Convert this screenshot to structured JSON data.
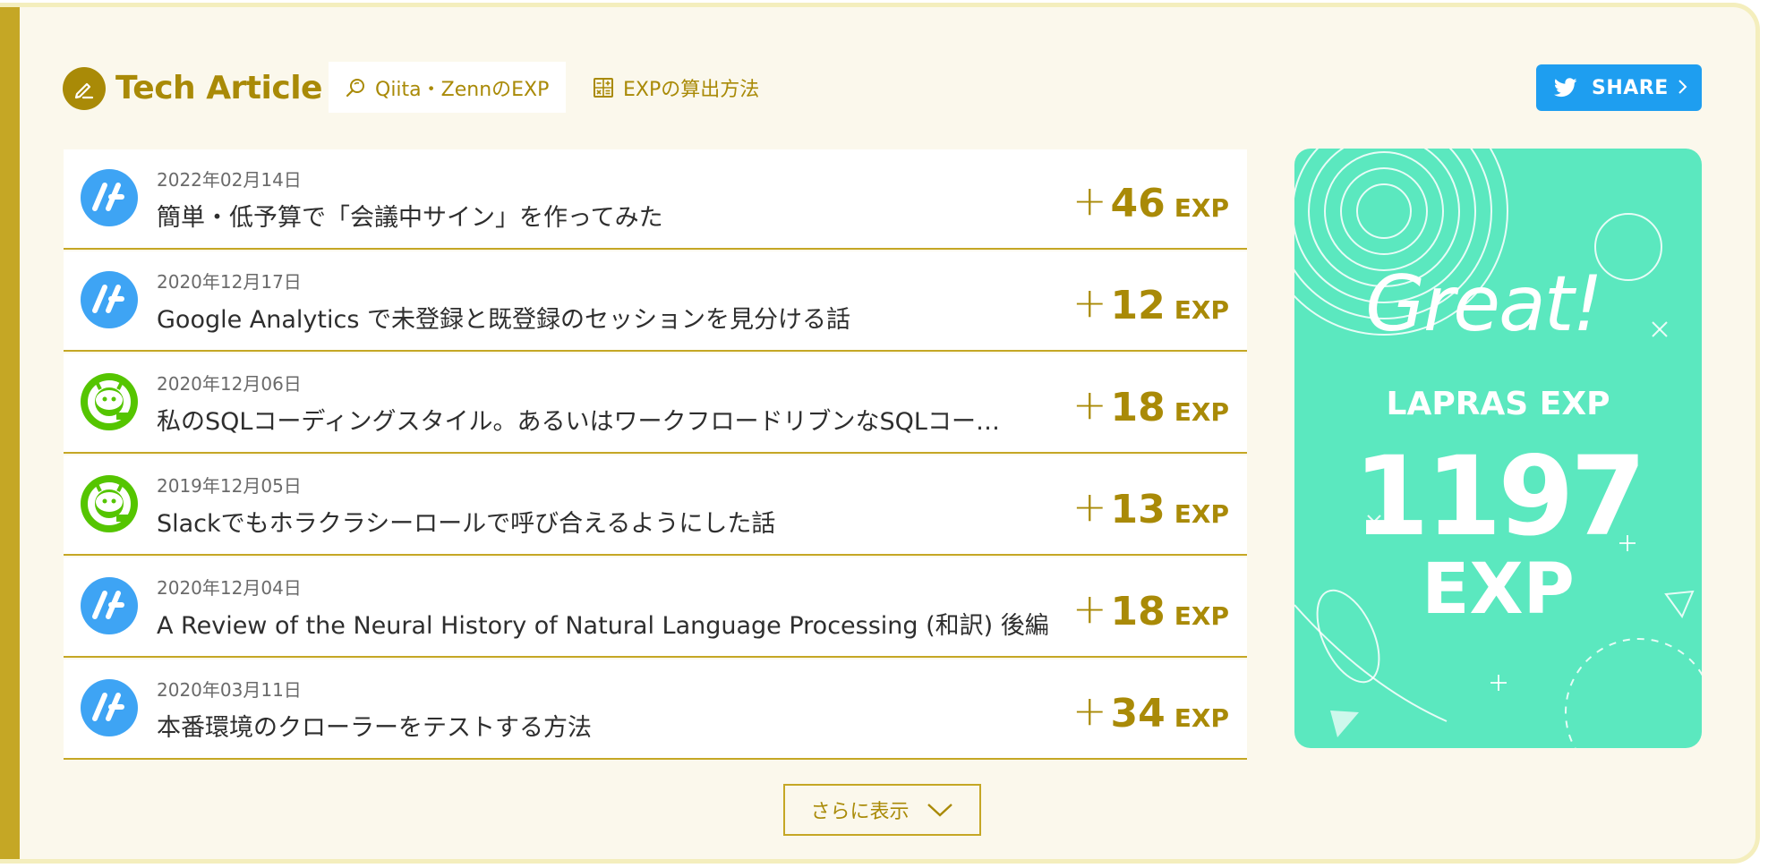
{
  "header": {
    "title": "Tech Article",
    "tabs": [
      {
        "label": "Qiita・ZennのEXP",
        "active": true
      },
      {
        "label": "EXPの算出方法",
        "active": false
      }
    ],
    "share_label": "SHARE"
  },
  "articles": [
    {
      "date": "2022年02月14日",
      "title": "簡単・低予算で「会議中サイン」を作ってみた",
      "exp": "46",
      "source_icon": "hatena-icon"
    },
    {
      "date": "2020年12月17日",
      "title": "Google Analytics で未登録と既登録のセッションを見分ける話",
      "exp": "12",
      "source_icon": "hatena-icon"
    },
    {
      "date": "2020年12月06日",
      "title": "私のSQLコーディングスタイル。あるいはワークフロードリブンなSQLコー…",
      "exp": "18",
      "source_icon": "qiita-icon"
    },
    {
      "date": "2019年12月05日",
      "title": "Slackでもホラクラシーロールで呼び合えるようにした話",
      "exp": "13",
      "source_icon": "qiita-icon"
    },
    {
      "date": "2020年12月04日",
      "title": "A Review of the Neural History of Natural Language Processing (和訳) 後編",
      "exp": "18",
      "source_icon": "hatena-icon"
    },
    {
      "date": "2020年03月11日",
      "title": "本番環境のクローラーをテストする方法",
      "exp": "34",
      "source_icon": "hatena-icon"
    }
  ],
  "exp_plus": "+",
  "exp_unit": "EXP",
  "more_label": "さらに表示",
  "badge": {
    "great": "Great!",
    "label": "LAPRAS EXP",
    "value": "1197",
    "unit": "EXP"
  },
  "colors": {
    "accent": "#a98a07",
    "accent_border": "#c5a725",
    "card_bg": "#fbf8ec",
    "twitter": "#1e9ef0",
    "badge_bg": "#5be8bf",
    "hatena": "#3ea4f4",
    "qiita": "#55c500"
  }
}
